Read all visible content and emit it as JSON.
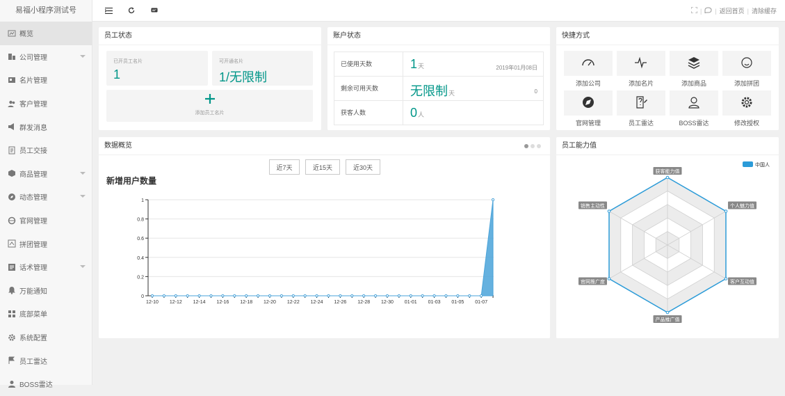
{
  "app": {
    "title": "易福小程序测试号"
  },
  "sidebar": {
    "items": [
      {
        "label": "概览",
        "icon": "dashboard-icon",
        "active": true,
        "expandable": false
      },
      {
        "label": "公司管理",
        "icon": "company-icon",
        "expandable": true
      },
      {
        "label": "名片管理",
        "icon": "card-icon",
        "expandable": false
      },
      {
        "label": "客户管理",
        "icon": "users-icon",
        "expandable": false
      },
      {
        "label": "群发消息",
        "icon": "megaphone-icon",
        "expandable": false
      },
      {
        "label": "员工交接",
        "icon": "handover-icon",
        "expandable": false
      },
      {
        "label": "商品管理",
        "icon": "cube-icon",
        "expandable": true
      },
      {
        "label": "动态管理",
        "icon": "compass-icon",
        "expandable": true
      },
      {
        "label": "官网管理",
        "icon": "web-icon",
        "expandable": false
      },
      {
        "label": "拼团管理",
        "icon": "group-icon",
        "expandable": false
      },
      {
        "label": "话术管理",
        "icon": "script-icon",
        "expandable": true
      },
      {
        "label": "万能通知",
        "icon": "bell-icon",
        "expandable": false
      },
      {
        "label": "底部菜单",
        "icon": "grid-icon",
        "expandable": false
      },
      {
        "label": "系统配置",
        "icon": "gear-icon",
        "expandable": false
      },
      {
        "label": "员工雷达",
        "icon": "flag-icon",
        "expandable": false
      },
      {
        "label": "BOSS雷达",
        "icon": "person-icon",
        "expandable": false
      }
    ]
  },
  "topbar": {
    "icons": [
      "menu-toggle-icon",
      "refresh-icon",
      "message-icon"
    ],
    "right_icons": [
      "fullscreen-icon",
      "theme-icon"
    ],
    "home_link": "返回首页",
    "clear_cache": "清除缓存"
  },
  "staff_status": {
    "title": "员工状态",
    "opened_label": "已开员工名片",
    "opened_value": "1",
    "available_label": "可开通名片",
    "available_value": "1/无限制",
    "add_label": "添加员工名片"
  },
  "account_status": {
    "title": "账户状态",
    "rows": [
      {
        "label": "已使用天数",
        "value": "1",
        "unit": "天",
        "right": "2019年01月08日"
      },
      {
        "label": "剩余可用天数",
        "value": "无限制",
        "unit": "天",
        "right": "0"
      },
      {
        "label": "获客人数",
        "value": "0",
        "unit": "人",
        "right": ""
      }
    ]
  },
  "shortcuts": {
    "title": "快捷方式",
    "items": [
      {
        "label": "添加公司",
        "icon": "gauge-icon"
      },
      {
        "label": "添加名片",
        "icon": "pulse-icon"
      },
      {
        "label": "添加商品",
        "icon": "layers-icon"
      },
      {
        "label": "添加拼团",
        "icon": "smile-icon"
      },
      {
        "label": "官网管理",
        "icon": "compass-icon"
      },
      {
        "label": "员工雷达",
        "icon": "edit-doc-icon"
      },
      {
        "label": "BOSS雷达",
        "icon": "user-icon"
      },
      {
        "label": "修改授权",
        "icon": "gear-icon"
      }
    ]
  },
  "data_overview": {
    "title": "数据概览",
    "ranges": [
      "近7天",
      "近15天",
      "近30天"
    ],
    "selected_range": "近30天",
    "carousel_dots": 3,
    "active_dot": 0
  },
  "ability": {
    "title": "员工能力值"
  },
  "chart_data": [
    {
      "type": "area",
      "title": "新增用户数量",
      "x": [
        "12-10",
        "12-11",
        "12-12",
        "12-13",
        "12-14",
        "12-15",
        "12-16",
        "12-17",
        "12-18",
        "12-19",
        "12-20",
        "12-21",
        "12-22",
        "12-23",
        "12-24",
        "12-25",
        "12-26",
        "12-27",
        "12-28",
        "12-29",
        "12-30",
        "12-31",
        "01-01",
        "01-02",
        "01-03",
        "01-04",
        "01-05",
        "01-06",
        "01-07",
        "01-08"
      ],
      "x_tick_labels": [
        "12-10",
        "12-12",
        "12-14",
        "12-16",
        "12-18",
        "12-20",
        "12-22",
        "12-24",
        "12-26",
        "12-28",
        "12-30",
        "01-01",
        "01-03",
        "01-05",
        "01-07"
      ],
      "values": [
        0,
        0,
        0,
        0,
        0,
        0,
        0,
        0,
        0,
        0,
        0,
        0,
        0,
        0,
        0,
        0,
        0,
        0,
        0,
        0,
        0,
        0,
        0,
        0,
        0,
        0,
        0,
        0,
        0,
        1
      ],
      "y_ticks": [
        "0",
        "0.2",
        "0.4",
        "0.6",
        "0.8",
        "1"
      ],
      "ylim": [
        0,
        1
      ],
      "grid": true,
      "color": "#4aa3d9"
    },
    {
      "type": "radar",
      "indicators": [
        "获客能力值",
        "个人魅力值",
        "客户互动值",
        "产品推广值",
        "官网推广度",
        "销售主动性"
      ],
      "legend": [
        "中国人"
      ],
      "legend_position": "top-right",
      "series": [
        {
          "name": "中国人",
          "values": [
            1,
            1,
            1,
            1,
            1,
            1
          ]
        }
      ],
      "max": 1,
      "color": "#2b9bd8"
    }
  ]
}
